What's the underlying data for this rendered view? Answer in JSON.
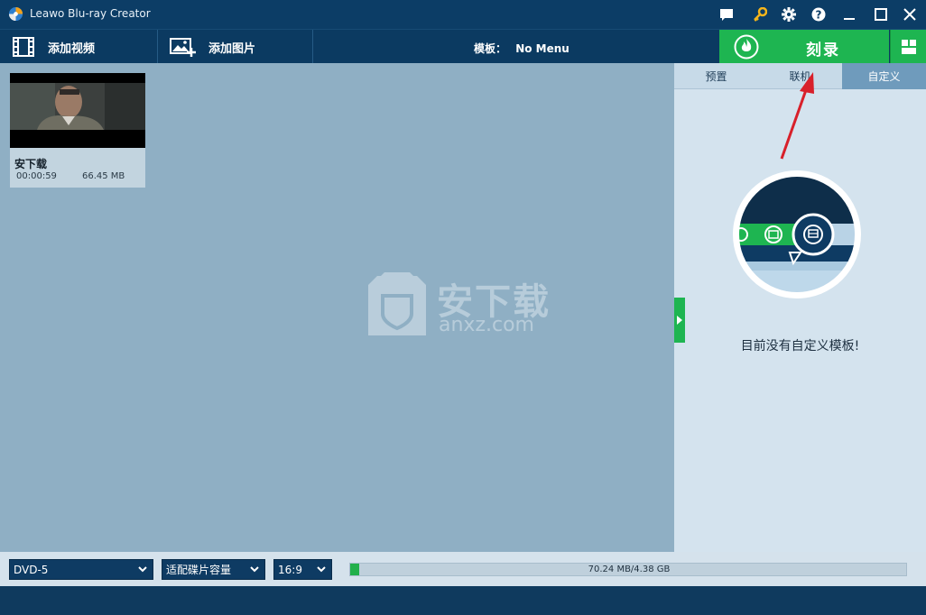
{
  "window": {
    "title": "Leawo Blu-ray Creator"
  },
  "titlebar_icons": [
    "chat-icon",
    "key-icon",
    "gear-icon",
    "help-icon",
    "minimize-icon",
    "maximize-icon",
    "close-icon"
  ],
  "toolbar": {
    "add_video_label": "添加视频",
    "add_photo_label": "添加图片",
    "template_prefix": "模板：",
    "template_value": "No Menu",
    "burn_label": "刻录"
  },
  "video": {
    "name": "安下载",
    "duration": "00:00:59",
    "size": "66.45 MB"
  },
  "watermark": {
    "text": "安下载",
    "sub": "anxz.com"
  },
  "right_panel": {
    "tabs": [
      {
        "label": "预置",
        "active": false
      },
      {
        "label": "联机",
        "active": false
      },
      {
        "label": "自定义",
        "active": true
      }
    ],
    "empty_message": "目前没有自定义模板!"
  },
  "bottom": {
    "disc_type": "DVD-5",
    "fit_mode": "适配碟片容量",
    "aspect": "16:9",
    "capacity_text": "70.24 MB/4.38 GB",
    "capacity_fraction": 0.016
  },
  "colors": {
    "accent_green": "#1eb551",
    "titlebar_blue": "#0c3d66",
    "main_bg": "#8fafc4",
    "annotation_red": "#d8202a"
  }
}
